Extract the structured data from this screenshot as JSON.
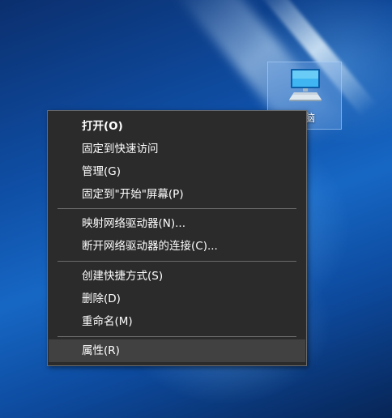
{
  "desktop": {
    "icon": {
      "label": "电脑",
      "icon_name": "this-pc-icon"
    }
  },
  "context_menu": {
    "items": [
      {
        "label": "打开(O)",
        "bold": true
      },
      {
        "label": "固定到快速访问"
      },
      {
        "label": "管理(G)"
      },
      {
        "label": "固定到\"开始\"屏幕(P)"
      },
      {
        "label": "映射网络驱动器(N)..."
      },
      {
        "label": "断开网络驱动器的连接(C)..."
      },
      {
        "label": "创建快捷方式(S)"
      },
      {
        "label": "删除(D)"
      },
      {
        "label": "重命名(M)"
      },
      {
        "label": "属性(R)",
        "highlighted": true
      }
    ]
  },
  "colors": {
    "menu_background": "#2b2b2b",
    "menu_highlight": "#414141",
    "menu_text": "#ffffff",
    "separator": "#6b6b6b"
  }
}
